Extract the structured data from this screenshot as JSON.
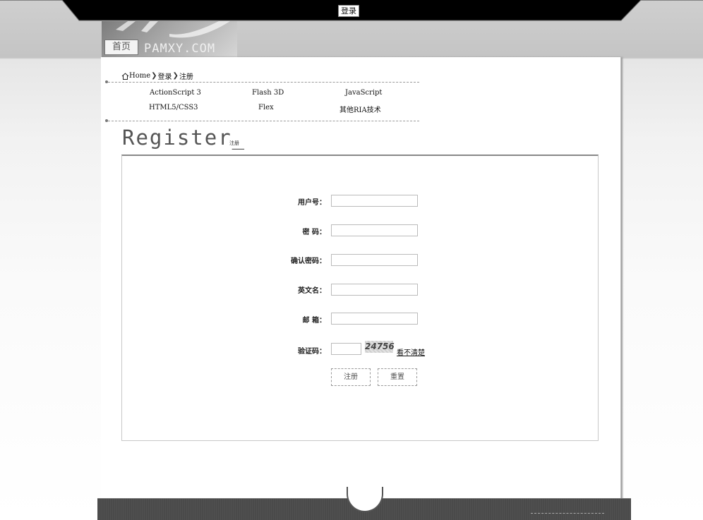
{
  "topbar": {
    "login_label": "登录"
  },
  "header": {
    "home_tab": "首页",
    "domain": "PAMXY.COM"
  },
  "breadcrumb": {
    "home": "Home",
    "items": [
      "登录",
      "注册"
    ]
  },
  "nav": {
    "row1": [
      "ActionScript 3",
      "Flash 3D",
      "JavaScript"
    ],
    "row2": [
      "HTML5/CSS3",
      "Flex",
      "其他RIA技术"
    ]
  },
  "page": {
    "title": "Register_",
    "subtitle": "注册"
  },
  "form": {
    "username_label": "用户号：",
    "password_label": "密  码：",
    "confirm_label": "确认密码：",
    "english_name_label": "英文名：",
    "email_label": "邮  箱：",
    "captcha_label": "验证码：",
    "captcha_code": "24756",
    "captcha_refresh": "看不清楚",
    "submit_label": "注册",
    "reset_label": "重置"
  },
  "colors": {
    "topbar": "#000000",
    "panel": "#ffffff",
    "footer": "#4a4a4a"
  }
}
